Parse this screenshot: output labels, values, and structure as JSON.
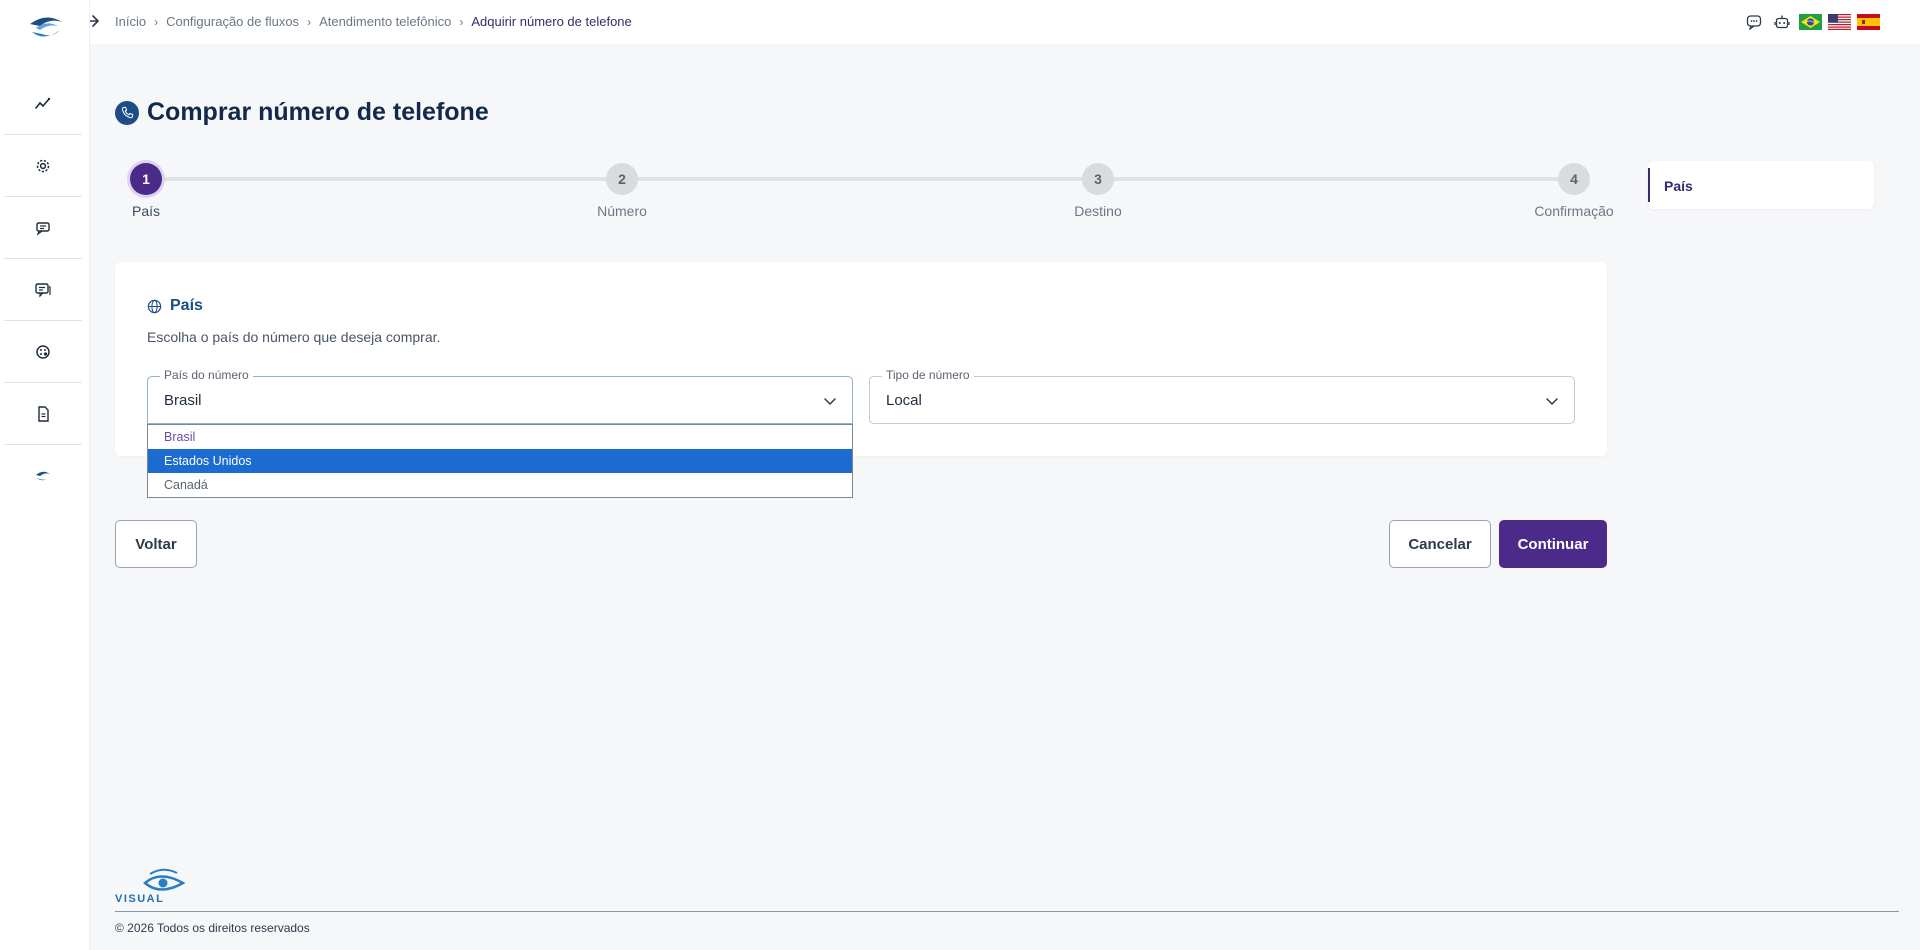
{
  "breadcrumb": [
    "Início",
    "Configuração de fluxos",
    "Atendimento telefônico",
    "Adquirir número de telefone"
  ],
  "page": {
    "title": "Comprar número de telefone"
  },
  "stepper": {
    "steps": [
      {
        "number": "1",
        "label": "País",
        "active": true
      },
      {
        "number": "2",
        "label": "Número",
        "active": false
      },
      {
        "number": "3",
        "label": "Destino",
        "active": false
      },
      {
        "number": "4",
        "label": "Confirmação",
        "active": false
      }
    ]
  },
  "side_nav": {
    "item": "País"
  },
  "card": {
    "title": "País",
    "description": "Escolha o país do número que deseja comprar."
  },
  "fields": {
    "country": {
      "label": "País do número",
      "value": "Brasil"
    },
    "type": {
      "label": "Tipo de número",
      "value": "Local"
    }
  },
  "dropdown": {
    "options": [
      "Brasil",
      "Estados Unidos",
      "Canadá"
    ],
    "selected": "Brasil",
    "highlighted": "Estados Unidos"
  },
  "buttons": {
    "back": "Voltar",
    "cancel": "Cancelar",
    "continue": "Continuar"
  },
  "footer": {
    "brand": "VISUAL",
    "copyright": "© 2026 Todos os direitos reservados"
  },
  "colors": {
    "primary": "#4b2a8a",
    "brand_blue": "#1d4c86",
    "highlight": "#1c6bd0"
  },
  "icons": {
    "sidebar": [
      "analytics-icon",
      "settings-gear-icon",
      "chat-list-icon",
      "messages-icon",
      "palette-icon",
      "document-icon",
      "brand-icon"
    ],
    "header": [
      "chat-icon",
      "robot-icon",
      "flag-brazil-icon",
      "flag-usa-icon",
      "flag-spain-icon"
    ]
  }
}
